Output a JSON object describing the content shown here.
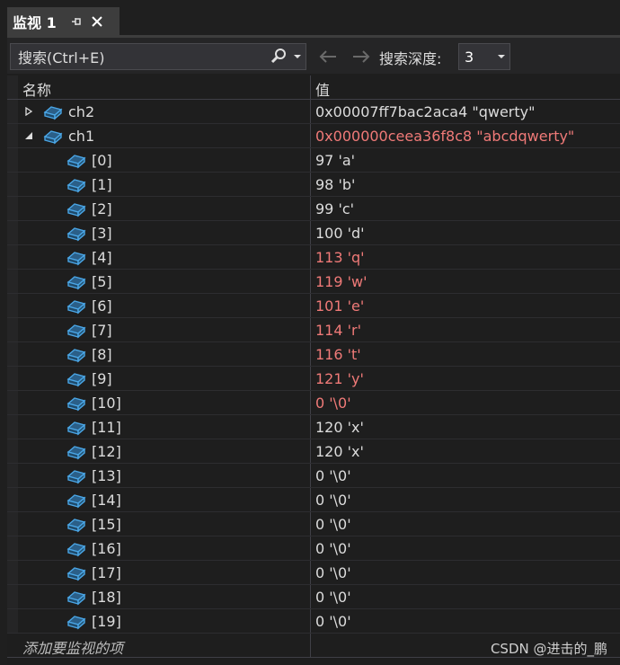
{
  "tab": {
    "title": "监视 1"
  },
  "toolbar": {
    "search_placeholder": "搜索(Ctrl+E)",
    "depth_label": "搜索深度:",
    "depth_value": "3"
  },
  "columns": {
    "name": "名称",
    "value": "值"
  },
  "rows": [
    {
      "name": "ch2",
      "value": "0x00007ff7bac2aca4 \"qwerty\"",
      "level": 0,
      "expander": "collapsed",
      "changed": false
    },
    {
      "name": "ch1",
      "value": "0x000000ceea36f8c8 \"abcdqwerty\"",
      "level": 0,
      "expander": "expanded",
      "changed": true
    },
    {
      "name": "[0]",
      "value": "97 'a'",
      "level": 1,
      "changed": false
    },
    {
      "name": "[1]",
      "value": "98 'b'",
      "level": 1,
      "changed": false
    },
    {
      "name": "[2]",
      "value": "99 'c'",
      "level": 1,
      "changed": false
    },
    {
      "name": "[3]",
      "value": "100 'd'",
      "level": 1,
      "changed": false
    },
    {
      "name": "[4]",
      "value": "113 'q'",
      "level": 1,
      "changed": true
    },
    {
      "name": "[5]",
      "value": "119 'w'",
      "level": 1,
      "changed": true
    },
    {
      "name": "[6]",
      "value": "101 'e'",
      "level": 1,
      "changed": true
    },
    {
      "name": "[7]",
      "value": "114 'r'",
      "level": 1,
      "changed": true
    },
    {
      "name": "[8]",
      "value": "116 't'",
      "level": 1,
      "changed": true
    },
    {
      "name": "[9]",
      "value": "121 'y'",
      "level": 1,
      "changed": true
    },
    {
      "name": "[10]",
      "value": "0 '\\0'",
      "level": 1,
      "changed": true
    },
    {
      "name": "[11]",
      "value": "120 'x'",
      "level": 1,
      "changed": false
    },
    {
      "name": "[12]",
      "value": "120 'x'",
      "level": 1,
      "changed": false
    },
    {
      "name": "[13]",
      "value": "0 '\\0'",
      "level": 1,
      "changed": false
    },
    {
      "name": "[14]",
      "value": "0 '\\0'",
      "level": 1,
      "changed": false
    },
    {
      "name": "[15]",
      "value": "0 '\\0'",
      "level": 1,
      "changed": false
    },
    {
      "name": "[16]",
      "value": "0 '\\0'",
      "level": 1,
      "changed": false
    },
    {
      "name": "[17]",
      "value": "0 '\\0'",
      "level": 1,
      "changed": false
    },
    {
      "name": "[18]",
      "value": "0 '\\0'",
      "level": 1,
      "changed": false
    },
    {
      "name": "[19]",
      "value": "0 '\\0'",
      "level": 1,
      "changed": false
    }
  ],
  "add_watch_label": "添加要监视的项",
  "watermark": "CSDN @进击的_鹏",
  "icons": {
    "tab": [
      "pin-icon",
      "close-icon"
    ],
    "toolbar": [
      "search-icon",
      "dropdown-icon",
      "back-arrow-icon",
      "forward-arrow-icon",
      "chevron-down-icon"
    ],
    "row": [
      "expand-icon",
      "collapse-icon",
      "variable-object-icon"
    ]
  },
  "colors": {
    "changed_value": "#f07a78",
    "normal_value": "#dcdcdc",
    "icon_blue": "#3f9fdf"
  }
}
